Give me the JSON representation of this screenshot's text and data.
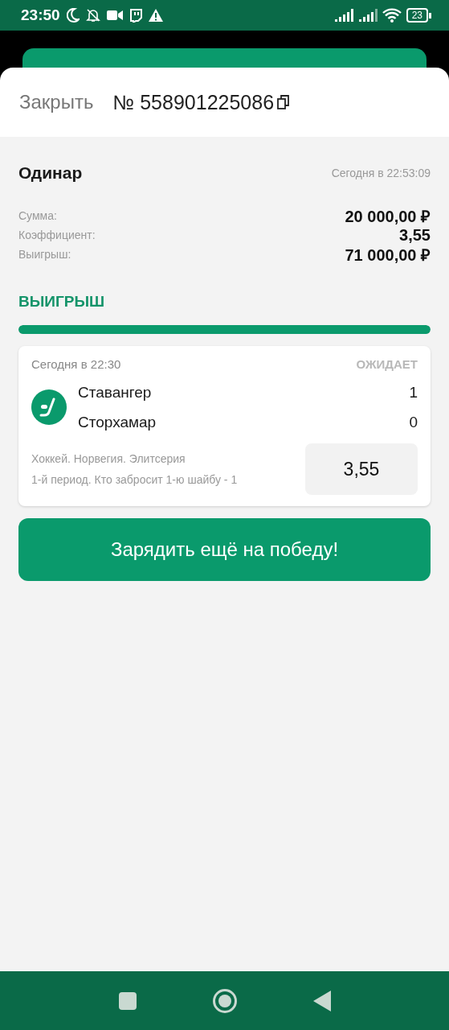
{
  "status_bar": {
    "time": "23:50",
    "battery": "23"
  },
  "header": {
    "close": "Закрыть",
    "number": "№ 558901225086"
  },
  "bet": {
    "type": "Одинар",
    "date": "Сегодня в 22:53:09",
    "details": [
      {
        "label": "Сумма:",
        "value": "20 000,00 ₽"
      },
      {
        "label": "Коэффициент:",
        "value": "3,55"
      },
      {
        "label": "Выигрыш:",
        "value": "71 000,00 ₽"
      }
    ],
    "result": "ВЫИГРЫШ",
    "progress": {
      "level": 1
    }
  },
  "event": {
    "time": "Сегодня в 22:30",
    "status": "ОЖИДАЕТ",
    "teams": [
      {
        "name": "Ставангер",
        "score": "1"
      },
      {
        "name": "Сторхамар",
        "score": "0"
      }
    ],
    "league": "Хоккей. Норвегия. Элитсерия",
    "market": "1-й период. Кто забросит 1-ю шайбу - 1",
    "odds": "3,55"
  },
  "action_button": "Зарядить ещё на победу!"
}
